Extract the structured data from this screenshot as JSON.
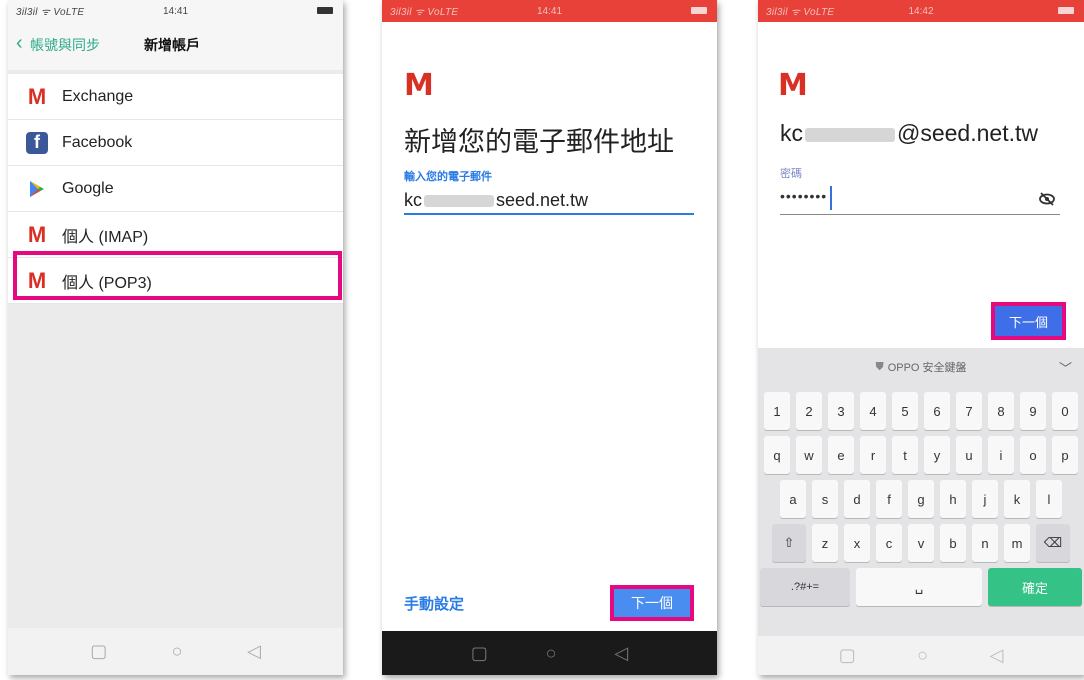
{
  "phone1": {
    "status": {
      "signal": "3il3il ᯤ VoLTE",
      "time": "14:41"
    },
    "back_label": "帳號與同步",
    "title": "新增帳戶",
    "accounts": [
      {
        "label": "Exchange",
        "icon": "gmail-m-icon"
      },
      {
        "label": "Facebook",
        "icon": "facebook-icon"
      },
      {
        "label": "Google",
        "icon": "google-play-icon"
      },
      {
        "label": "個人 (IMAP)",
        "icon": "gmail-m-icon"
      },
      {
        "label": "個人 (POP3)",
        "icon": "gmail-m-icon"
      }
    ],
    "highlighted_index": 4
  },
  "phone2": {
    "status": {
      "signal": "3il3il ᯤ VoLTE",
      "time": "14:41"
    },
    "logo": "M",
    "heading": "新增您的電子郵件地址",
    "field_label": "輸入您的電子郵件",
    "email_prefix": "kc",
    "email_suffix": "seed.net.tw",
    "manual_setup": "手動設定",
    "next": "下一個"
  },
  "phone3": {
    "status": {
      "signal": "3il3il ᯤ VoLTE",
      "time": "14:42"
    },
    "logo": "M",
    "email_prefix": "kc",
    "email_suffix": "@seed.net.tw",
    "password_label": "密碼",
    "password_value": "••••••••",
    "next": "下一個",
    "keyboard": {
      "header": "OPPO 安全鍵盤",
      "row_numbers": [
        "1",
        "2",
        "3",
        "4",
        "5",
        "6",
        "7",
        "8",
        "9",
        "0"
      ],
      "row_1": [
        "q",
        "w",
        "e",
        "r",
        "t",
        "y",
        "u",
        "i",
        "o",
        "p"
      ],
      "row_2": [
        "a",
        "s",
        "d",
        "f",
        "g",
        "h",
        "j",
        "k",
        "l"
      ],
      "row_3": [
        "z",
        "x",
        "c",
        "v",
        "b",
        "n",
        "m"
      ],
      "symbols": ".?#+=",
      "confirm": "確定"
    }
  },
  "colors": {
    "highlight": "#e5087e",
    "accent_blue": "#2a7be6",
    "gmail_red": "#d93025",
    "confirm_green": "#34c287",
    "back_teal": "#2eaa8a"
  }
}
